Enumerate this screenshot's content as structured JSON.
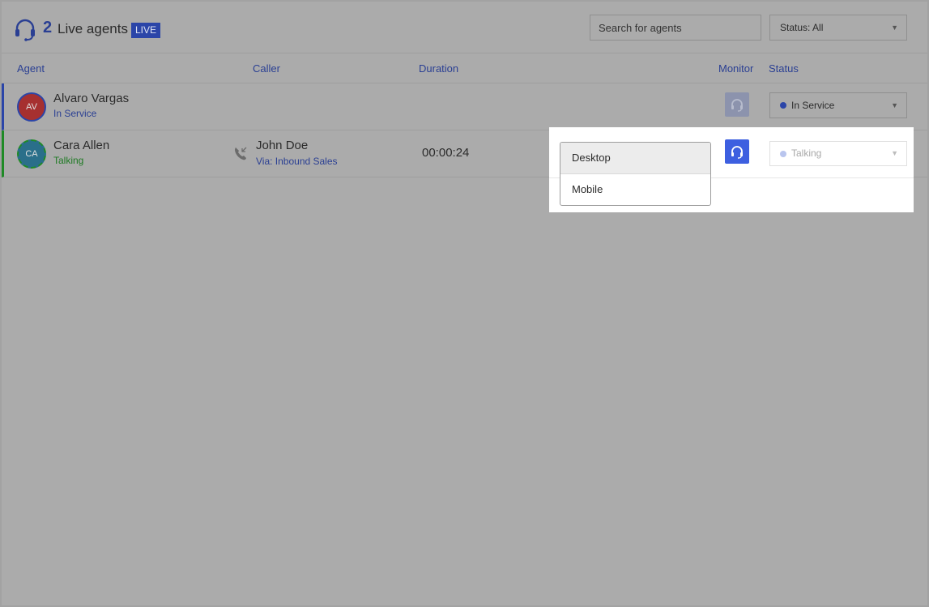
{
  "header": {
    "agent_count": "2",
    "title": "Live agents",
    "live_badge": "LIVE",
    "search_placeholder": "Search for agents",
    "status_filter": "Status: All"
  },
  "columns": {
    "agent": "Agent",
    "caller": "Caller",
    "duration": "Duration",
    "monitor": "Monitor",
    "status": "Status"
  },
  "agents": [
    {
      "initials": "AV",
      "name": "Alvaro Vargas",
      "status": "In Service",
      "status_select": "In Service",
      "status_color": "#2b45a8"
    },
    {
      "initials": "CA",
      "name": "Cara Allen",
      "status": "Talking",
      "caller": "John Doe",
      "via": "Via: Inbound Sales",
      "duration": "00:00:24",
      "status_select": "Talking",
      "status_color": "#b9c5ee"
    }
  ],
  "monitor_menu": {
    "options": [
      "Desktop",
      "Mobile"
    ],
    "selected": "Desktop"
  },
  "icons": {
    "header": "headset-icon",
    "monitor": "headset-icon",
    "call": "incoming-call-icon",
    "dropdown": "chevron-down-icon"
  },
  "colors": {
    "brand_blue": "#2a3f93",
    "accent_blue": "#3d5fe0",
    "talking_green": "#1f8a26",
    "overlay_gray": "#ababab"
  }
}
